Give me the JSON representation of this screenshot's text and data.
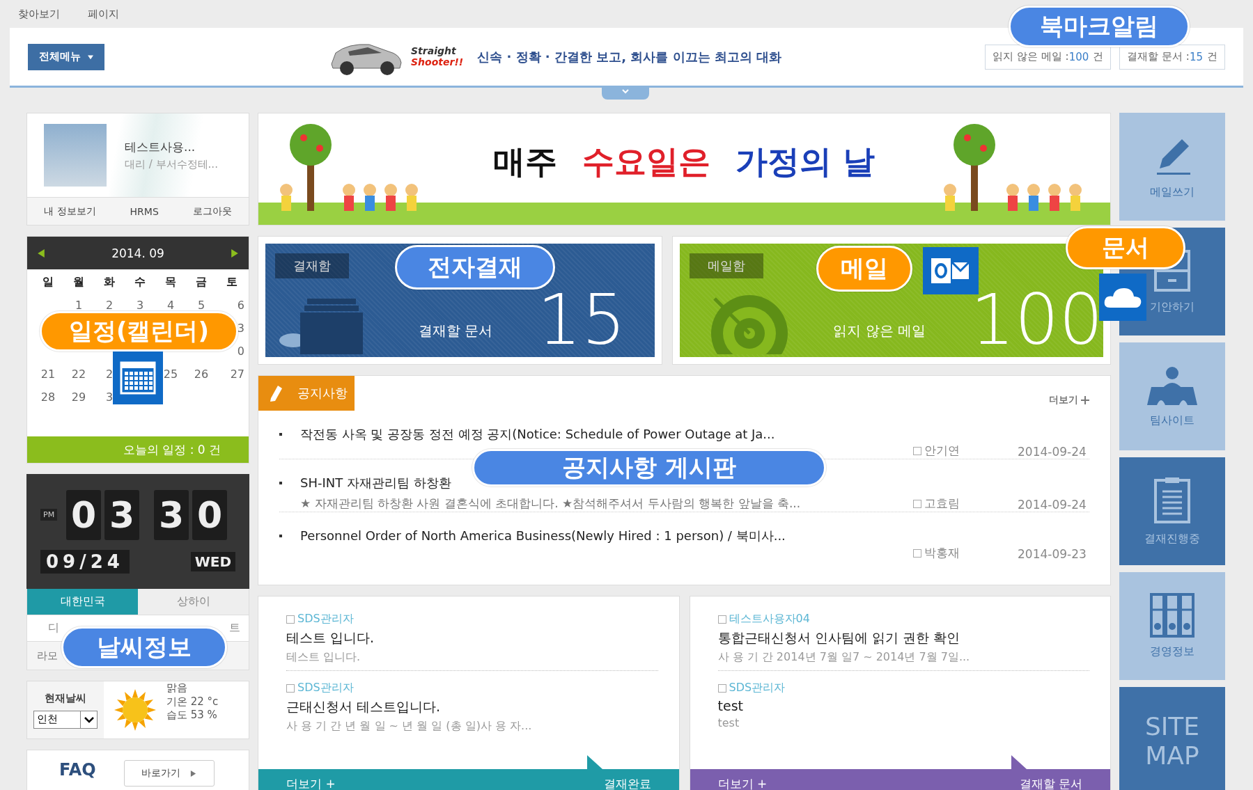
{
  "top_links": [
    "찾아보기",
    "페이지"
  ],
  "header": {
    "menu_button": "전체메뉴",
    "logo": {
      "line1": "Straight",
      "line2": "Shooter!!"
    },
    "tagline": "신속 · 정확 · 간결한 보고, 회사를 이끄는 최고의 대화",
    "counters": [
      {
        "label": "읽지 않은 메일 : ",
        "value": "100",
        "unit": "건"
      },
      {
        "label": "결재할 문서 : ",
        "value": "15",
        "unit": "건"
      }
    ]
  },
  "profile": {
    "name": "테스트사용...",
    "position": "대리 / 부서수정테...",
    "links": [
      "내 정보보기",
      "HRMS",
      "로그아웃"
    ]
  },
  "calendar": {
    "month": "2014. 09",
    "weekdays": [
      "일",
      "월",
      "화",
      "수",
      "목",
      "금",
      "토"
    ],
    "weeks": [
      {
        "mon": "1",
        "tue": "2",
        "wed": "3",
        "thu": "4",
        "fri": "5",
        "sat": "6"
      },
      {
        "sat": "3"
      },
      {
        "sat": "0"
      },
      {
        "sun": "21",
        "mon": "22",
        "tue": "2",
        "thu": "25",
        "fri": "26",
        "sat": "27"
      },
      {
        "sun": "28",
        "mon": "29",
        "tue": "3"
      }
    ],
    "today": "오늘의 일정 : 0 건"
  },
  "clock": {
    "ampm": "PM",
    "digits": [
      "0",
      "3",
      "3",
      "0"
    ],
    "date": "09/24",
    "weekday": "WED"
  },
  "weather": {
    "tabs": [
      {
        "label": "대한민국",
        "selected": true
      },
      {
        "label": "상하이",
        "selected": false
      },
      {
        "label": "디",
        "selected": false
      },
      {
        "label": "트",
        "selected": false
      }
    ],
    "city_line": "라모",
    "current_label": "현재날씨",
    "city": "인천",
    "condition": "맑음",
    "temperature": "기온 22 °c",
    "humidity": "습도 53 %"
  },
  "faq": {
    "title": "FAQ",
    "button": "바로가기"
  },
  "banner": {
    "parts": [
      {
        "text": "매주",
        "color": "#111111"
      },
      {
        "text": "수요일은",
        "color": "#e0202a"
      },
      {
        "text": "가정의 날",
        "color": "#1a3fb8"
      }
    ]
  },
  "cards": [
    {
      "label": "결재함",
      "caption": "결재할 문서",
      "count": "15",
      "color": "#2c5b93"
    },
    {
      "label": "메일함",
      "caption": "읽지 않은 메일",
      "count": "100",
      "color": "#86b81e"
    }
  ],
  "notices": {
    "title": "공지사항",
    "more": "더보기",
    "items": [
      {
        "title": "작전동 사옥 및 공장동 정전 예정 공지(Notice: Schedule of Power Outage at Ja...",
        "author": "안기연",
        "date": "2014-09-24"
      },
      {
        "title": "SH-INT 자재관리팀 하창환",
        "summary": "★ 자재관리팀 하창환 사원 결혼식에 초대합니다. ★참석해주셔서 두사람의 행복한 앞날을 축...",
        "author": "고효림",
        "date": "2014-09-24"
      },
      {
        "title": "Personnel Order of North America Business(Newly Hired : 1 person) / 북미사...",
        "author": "박홍재",
        "date": "2014-09-23"
      }
    ]
  },
  "boards": [
    {
      "color": "#1f9ba6",
      "more": "더보기 +",
      "label": "결재완료",
      "items": [
        {
          "author": "SDS관리자",
          "title": "테스트 입니다.",
          "summary": "테스트 입니다."
        },
        {
          "author": "SDS관리자",
          "title": "근태신청서 테스트입니다.",
          "summary": "사 용 기 간 년 월 일 ~ 년 월 일 (총 일)사 용 자..."
        }
      ]
    },
    {
      "color": "#7b5fae",
      "more": "더보기 +",
      "label": "결재할 문서",
      "items": [
        {
          "author": "테스트사용자04",
          "title": "통합근태신청서 인사팀에 읽기 권한 확인",
          "summary": "사 용 기 간 2014년 7월 일7 ~ 2014년 7월 7일..."
        },
        {
          "author": "SDS관리자",
          "title": "test",
          "summary": "test"
        }
      ]
    }
  ],
  "quick_tiles": [
    {
      "label": "메일쓰기",
      "color": "#a9c3df"
    },
    {
      "label": "기안하기",
      "color": "#3f71a8"
    },
    {
      "label": "팀사이트",
      "color": "#a9c3df"
    },
    {
      "label": "결재진행중",
      "color": "#3f71a8"
    },
    {
      "label": "경영정보",
      "color": "#a9c3df"
    },
    {
      "label": "SITE MAP",
      "color": "#3f71a8"
    }
  ],
  "callouts": [
    {
      "text": "북마크알림",
      "color": "#4a86e3"
    },
    {
      "text": "전자결재",
      "color": "#4a86e3"
    },
    {
      "text": "메일",
      "color": "#ff9800"
    },
    {
      "text": "문서",
      "color": "#ff9800"
    },
    {
      "text": "일정(캘린더)",
      "color": "#ff9800"
    },
    {
      "text": "공지사항 게시판",
      "color": "#4a86e3"
    },
    {
      "text": "날씨정보",
      "color": "#4a86e3"
    }
  ]
}
